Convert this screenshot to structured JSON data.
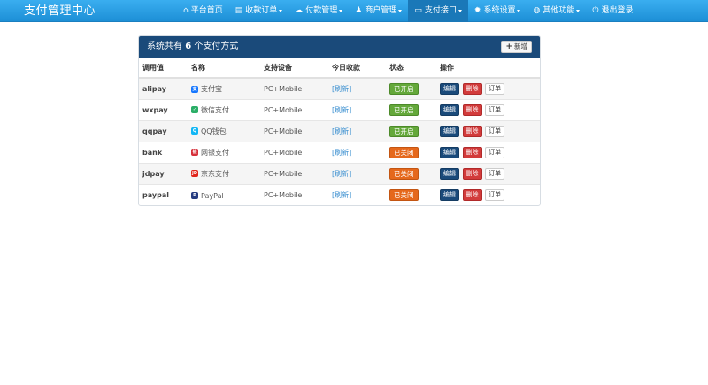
{
  "navbar": {
    "brand": "支付管理中心",
    "items": [
      {
        "icon": "home-icon",
        "glyph": "⌂",
        "label": "平台首页",
        "dropdown": false
      },
      {
        "icon": "list-icon",
        "glyph": "▤",
        "label": "收款订单",
        "dropdown": true
      },
      {
        "icon": "cloud-icon",
        "glyph": "☁",
        "label": "付款管理",
        "dropdown": true
      },
      {
        "icon": "user-icon",
        "glyph": "♟",
        "label": "商户管理",
        "dropdown": true
      },
      {
        "icon": "card-icon",
        "glyph": "▭",
        "label": "支付接口",
        "dropdown": true
      },
      {
        "icon": "gear-icon",
        "glyph": "✹",
        "label": "系统设置",
        "dropdown": true
      },
      {
        "icon": "globe-icon",
        "glyph": "◍",
        "label": "其他功能",
        "dropdown": true
      },
      {
        "icon": "power-icon",
        "glyph": "⏻",
        "label": "退出登录",
        "dropdown": false
      }
    ],
    "active_index": 4
  },
  "panel": {
    "title_prefix": "系统共有",
    "count": "6",
    "title_suffix": "个支付方式",
    "new_button": "新增"
  },
  "table": {
    "headers": [
      "调用值",
      "名称",
      "支持设备",
      "今日收款",
      "状态",
      "操作"
    ],
    "rows": [
      {
        "code": "alipay",
        "name": "支付宝",
        "icon": "alipay-icon",
        "icon_color": "#1677ff",
        "icon_char": "支",
        "device": "PC+Mobile",
        "today": "[刷新]",
        "status": "已开启",
        "enabled": true
      },
      {
        "code": "wxpay",
        "name": "微信支付",
        "icon": "wechat-icon",
        "icon_color": "#2aae67",
        "icon_char": "✓",
        "device": "PC+Mobile",
        "today": "[刷新]",
        "status": "已开启",
        "enabled": true
      },
      {
        "code": "qqpay",
        "name": "QQ钱包",
        "icon": "qq-icon",
        "icon_color": "#12b7f5",
        "icon_char": "Q",
        "device": "PC+Mobile",
        "today": "[刷新]",
        "status": "已开启",
        "enabled": true
      },
      {
        "code": "bank",
        "name": "网银支付",
        "icon": "unionpay-icon",
        "icon_color": "#d6303a",
        "icon_char": "银",
        "device": "PC+Mobile",
        "today": "[刷新]",
        "status": "已关闭",
        "enabled": false
      },
      {
        "code": "jdpay",
        "name": "京东支付",
        "icon": "jd-icon",
        "icon_color": "#e1251b",
        "icon_char": "JD",
        "device": "PC+Mobile",
        "today": "[刷新]",
        "status": "已关闭",
        "enabled": false
      },
      {
        "code": "paypal",
        "name": "PayPal",
        "icon": "paypal-icon",
        "icon_color": "#253b80",
        "icon_char": "P",
        "device": "PC+Mobile",
        "today": "[刷新]",
        "status": "已关闭",
        "enabled": false
      }
    ],
    "actions": {
      "edit": "编辑",
      "delete": "删除",
      "orders": "订单"
    }
  }
}
